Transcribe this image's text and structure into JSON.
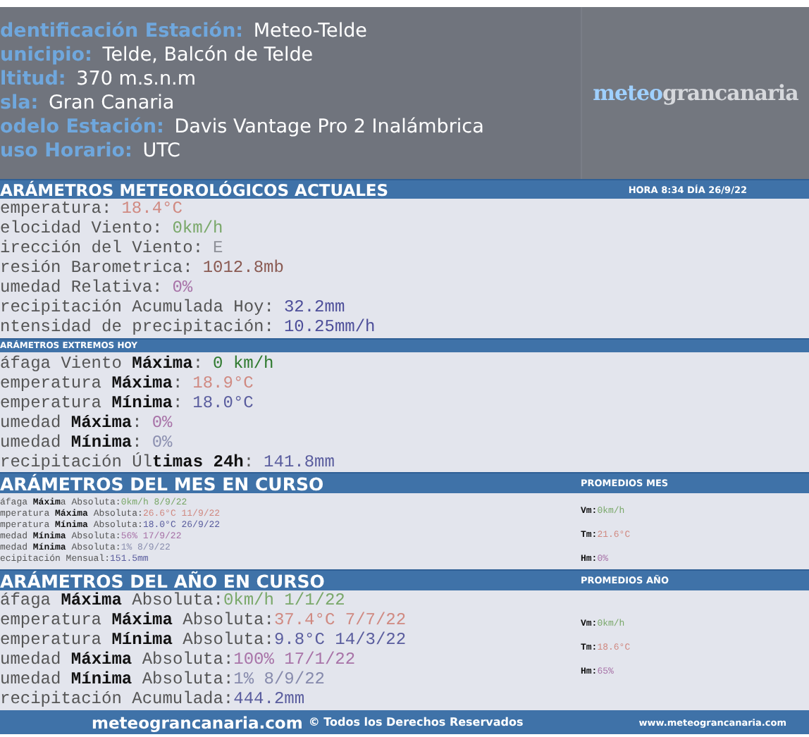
{
  "header": {
    "fields": [
      {
        "label": "dentificación Estación:",
        "value": "Meteo-Telde"
      },
      {
        "label": "unicipio:",
        "value": "Telde, Balcón de Telde"
      },
      {
        "label": "ltitud:",
        "value": "370 m.s.n.m"
      },
      {
        "label": "sla:",
        "value": "Gran Canaria"
      },
      {
        "label": "odelo Estación:",
        "value": "Davis Vantage Pro 2 Inalámbrica"
      },
      {
        "label": "uso Horario:",
        "value": "UTC"
      }
    ],
    "logo": {
      "part1": "meteo",
      "part2": "grancanaria"
    }
  },
  "sections": [
    {
      "kind": "current",
      "title": "ARÁMETROS METEOROLÓGICOS ACTUALES",
      "time": "HORA 8:34  DÍA 26/9/22",
      "rows": [
        {
          "label": "emperatura:",
          "value": "18.4°C",
          "color": "#d08a82"
        },
        {
          "label": "elocidad Viento:",
          "value": "0km/h",
          "color": "#7aa86a"
        },
        {
          "label": "irección del Viento:",
          "value": "E",
          "color": "#8e9098"
        },
        {
          "label": "resión Barometrica:",
          "value": "1012.8mb",
          "color": "#8a5a52"
        },
        {
          "label": "umedad Relativa:",
          "value": "0%",
          "color": "#a873a8"
        },
        {
          "label": "recipitación Acumulada Hoy:",
          "value": "32.2mm",
          "color": "#4e4f9a"
        },
        {
          "label": "ntensidad de precipitación:",
          "value": "10.25mm/h",
          "color": "#4e4f9a"
        }
      ]
    },
    {
      "kind": "extremes",
      "title": "ARÁMETROS EXTREMOS HOY",
      "rows": [
        {
          "label": "áfaga Viento **Máxima**:",
          "value": "0 km/h",
          "color": "#2f7a2f"
        },
        {
          "label": "emperatura **Máxima**:",
          "value": "18.9°C",
          "color": "#d08a82"
        },
        {
          "label": "emperatura **Mínima**:",
          "value": "18.0°C",
          "color": "#5a5d9e"
        },
        {
          "label": "umedad **Máxima**:",
          "value": "0%",
          "color": "#a873a8"
        },
        {
          "label": "umedad **Mínima**:",
          "value": "0%",
          "color": "#8c90b0"
        },
        {
          "label": "recipitación Úl**timas 24h**:",
          "value": "141.8mm",
          "color": "#5a5d9e"
        }
      ]
    },
    {
      "kind": "month",
      "title": "ARÁMETROS DEL MES EN CURSO",
      "side_title": "PROMEDIOS MES",
      "rows": [
        {
          "label": "áfaga **Máxim**a Absoluta:",
          "value": "0km/h 8/9/22",
          "color": "#7aa86a"
        },
        {
          "label": "mperatura **Máxima** Absoluta:",
          "value": "26.6°C 11/9/22",
          "color": "#d08a82"
        },
        {
          "label": "mperatura **Mínima** Absoluta:",
          "value": "18.0°C 26/9/22",
          "color": "#5a5d9e"
        },
        {
          "label": "medad **Mínima** Absoluta:",
          "value": "56% 17/9/22",
          "color": "#a873a8"
        },
        {
          "label": "medad **Mínima** Absoluta:",
          "value": "1% 8/9/22",
          "color": "#8c90b0"
        },
        {
          "label": "ecipitación Mensual:",
          "value": "151.5mm",
          "color": "#5a5d9e"
        }
      ],
      "side_rows": [
        {
          "label": "Vm:",
          "value": "0km/h",
          "color": "#7aa86a"
        },
        {
          "label": "Tm:",
          "value": "21.6°C",
          "color": "#d08a82"
        },
        {
          "label": "Hm:",
          "value": "0%",
          "color": "#a873a8"
        }
      ]
    },
    {
      "kind": "year",
      "title": "ARÁMETROS DEL AÑO EN CURSO",
      "side_title": "PROMEDIOS AÑO",
      "rows": [
        {
          "label": "áfaga **Máxima** Absoluta:",
          "value": "0km/h 1/1/22",
          "color": "#7aa86a"
        },
        {
          "label": "emperatura **Máxima** Absoluta:",
          "value": "37.4°C 7/7/22",
          "color": "#d08a82"
        },
        {
          "label": "emperatura **Mínima** Absoluta:",
          "value": "9.8°C 14/3/22",
          "color": "#5a5d9e"
        },
        {
          "label": "umedad **Máxima** Absoluta:",
          "value": "100% 17/1/22",
          "color": "#a873a8"
        },
        {
          "label": "umedad **Mínima** Absoluta:",
          "value": "1% 8/9/22",
          "color": "#868aac"
        },
        {
          "label": "recipitación Acumulada:",
          "value": "444.2mm",
          "color": "#5a5d9e"
        }
      ],
      "side_rows": [
        {
          "label": "Vm:",
          "value": "0km/h",
          "color": "#7aa86a"
        },
        {
          "label": "Tm:",
          "value": "18.6°C",
          "color": "#d08a82"
        },
        {
          "label": "Hm:",
          "value": "65%",
          "color": "#a873a8"
        }
      ]
    }
  ],
  "footer": {
    "site": "meteograncanaria.com",
    "rights": "© Todos los Derechos Reservados",
    "url": "www.meteograncanaria.com"
  }
}
